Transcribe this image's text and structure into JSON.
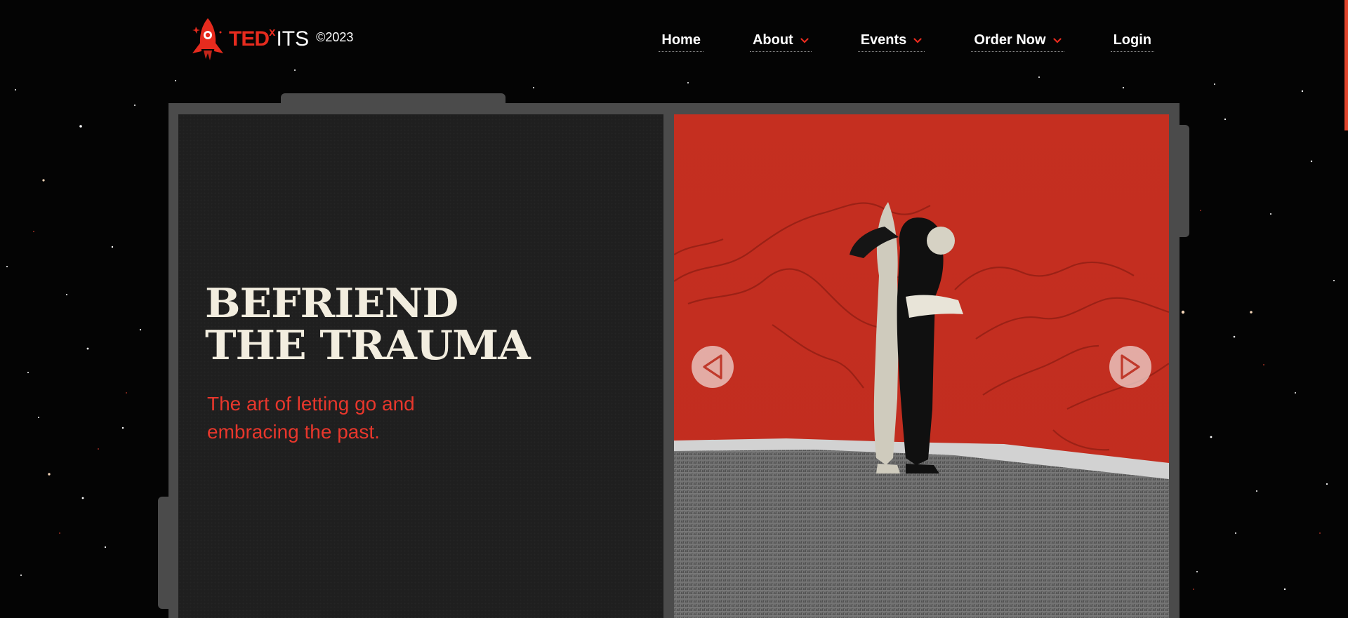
{
  "brand": {
    "ted": "TED",
    "x": "x",
    "its": "ITS",
    "year": "©2023",
    "logo_icon": "rocket-icon",
    "accent": "#e62b1e"
  },
  "nav": {
    "items": [
      {
        "label": "Home",
        "has_dropdown": false
      },
      {
        "label": "About",
        "has_dropdown": true
      },
      {
        "label": "Events",
        "has_dropdown": true
      },
      {
        "label": "Order Now",
        "has_dropdown": true
      },
      {
        "label": "Login",
        "has_dropdown": false
      }
    ],
    "dropdown_icon": "chevron-down-icon"
  },
  "hero": {
    "headline_line1": "BEFRIEND",
    "headline_line2": "THE TRAUMA",
    "subtitle": "The art of letting go and embracing the past.",
    "prev_icon": "triangle-left-icon",
    "next_icon": "triangle-right-icon"
  },
  "colors": {
    "background": "#040404",
    "frame": "#4b4b4b",
    "panel": "#1f1f1f",
    "headline": "#f2eddf",
    "subtitle": "#e8372c",
    "artwork_red": "#c23121"
  }
}
